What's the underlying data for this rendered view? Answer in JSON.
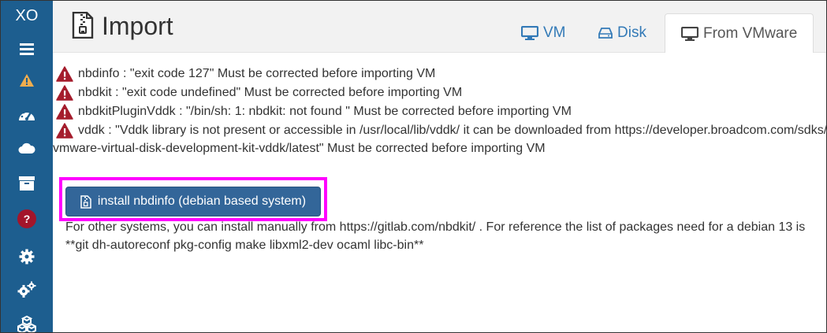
{
  "sidebar": {
    "logo": "XO"
  },
  "header": {
    "title": "Import",
    "tabs": [
      {
        "label": "VM"
      },
      {
        "label": "Disk"
      },
      {
        "label": "From VMware"
      }
    ]
  },
  "messages": [
    "nbdinfo : \"exit code 127\" Must be corrected before importing VM",
    "nbdkit : \"exit code undefined\" Must be corrected before importing VM",
    "nbdkitPluginVddk : \"/bin/sh: 1: nbdkit: not found \" Must be corrected before importing VM",
    "vddk : \"Vddk library is not present or accessible in /usr/local/lib/vddk/ it can be downloaded from https://developer.broadcom.com/sdks/"
  ],
  "message_continuation": "vmware-virtual-disk-development-kit-vddk/latest\" Must be corrected before importing VM",
  "install_button": "install nbdinfo (debian based system)",
  "info_line1": "For other systems, you can install manually from https://gitlab.com/nbdkit/ . For reference the list of packages need for a debian 13 is",
  "info_line2": "**git dh-autoreconf pkg-config make libxml2-dev ocaml libc-bin**",
  "colors": {
    "sidebar": "#1d5e8f",
    "button": "#336699",
    "warning": "#a94442",
    "highlight": "#ff00ff",
    "tab_link": "#337ab7"
  }
}
